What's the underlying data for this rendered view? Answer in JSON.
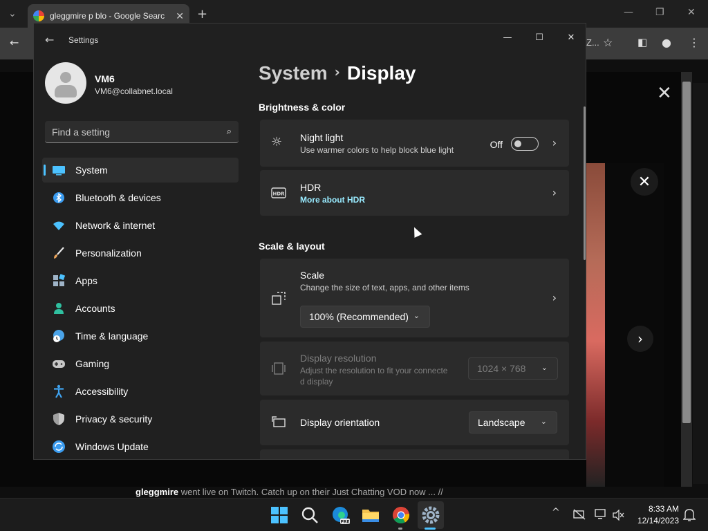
{
  "browser": {
    "tab_title": "gleggmire p blo - Google Searc",
    "tab_close": "✕",
    "new_tab": "+",
    "nav_back": "←",
    "address_fragment": "Z...",
    "bottom_channel": "gleggmire",
    "bottom_text": " went live on Twitch. Catch up on their Just Chatting VOD now ... //"
  },
  "settings": {
    "app_title": "Settings",
    "window_controls": {
      "minimize": "—",
      "maximize": "☐",
      "close": "✕"
    },
    "profile": {
      "name": "VM6",
      "email": "VM6@collabnet.local"
    },
    "search": {
      "placeholder": "Find a setting"
    },
    "nav": [
      {
        "label": "System",
        "icon": "system-icon",
        "color": "#4cc2ff"
      },
      {
        "label": "Bluetooth & devices",
        "icon": "bluetooth-icon",
        "color": "#3b9cf0"
      },
      {
        "label": "Network & internet",
        "icon": "wifi-icon",
        "color": "#4cc2ff"
      },
      {
        "label": "Personalization",
        "icon": "brush-icon",
        "color": "#e8a25a"
      },
      {
        "label": "Apps",
        "icon": "apps-icon",
        "color": "#9fb4c8"
      },
      {
        "label": "Accounts",
        "icon": "accounts-icon",
        "color": "#2fbf9f"
      },
      {
        "label": "Time & language",
        "icon": "globe-clock-icon",
        "color": "#4aa3e8"
      },
      {
        "label": "Gaming",
        "icon": "gamepad-icon",
        "color": "#c8c8c8"
      },
      {
        "label": "Accessibility",
        "icon": "accessibility-icon",
        "color": "#3fa3f0"
      },
      {
        "label": "Privacy & security",
        "icon": "shield-icon",
        "color": "#a0a0a0"
      },
      {
        "label": "Windows Update",
        "icon": "update-icon",
        "color": "#3b9cf0"
      }
    ],
    "breadcrumb": {
      "parent": "System",
      "separator": "›",
      "current": "Display"
    },
    "sections": {
      "brightness_title": "Brightness & color",
      "scale_title": "Scale & layout"
    },
    "night_light": {
      "title": "Night light",
      "subtitle": "Use warmer colors to help block blue light",
      "state": "Off"
    },
    "hdr": {
      "title": "HDR",
      "link": "More about HDR"
    },
    "scale": {
      "title": "Scale",
      "subtitle": "Change the size of text, apps, and other items",
      "value": "100% (Recommended)"
    },
    "resolution": {
      "title": "Display resolution",
      "subtitle_line1": "Adjust the resolution to fit your connecte",
      "subtitle_line2": "d display",
      "value": "1024 × 768"
    },
    "orientation": {
      "title": "Display orientation",
      "value": "Landscape"
    }
  },
  "taskbar": {
    "time": "8:33 AM",
    "date": "12/14/2023",
    "tray_chevron": "^"
  }
}
